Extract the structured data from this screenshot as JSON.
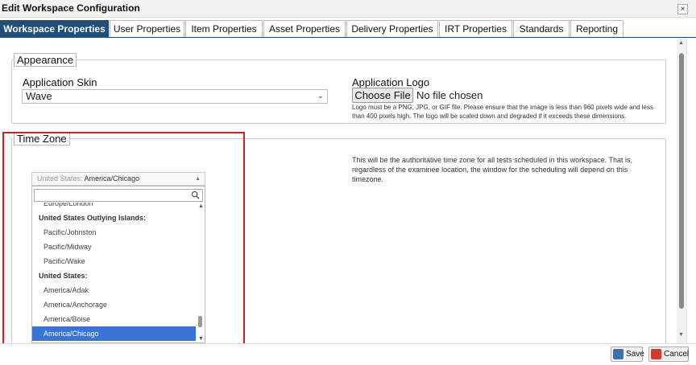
{
  "dialog": {
    "title": "Edit Workspace Configuration",
    "close_label": "×"
  },
  "tabs": [
    {
      "label": "Workspace Properties",
      "active": true
    },
    {
      "label": "User Properties"
    },
    {
      "label": "Item Properties"
    },
    {
      "label": "Asset Properties"
    },
    {
      "label": "Delivery Properties"
    },
    {
      "label": "IRT Properties"
    },
    {
      "label": "Standards"
    },
    {
      "label": "Reporting"
    }
  ],
  "appearance": {
    "legend": "Appearance",
    "skin_label": "Application Skin",
    "skin_value": "Wave",
    "logo_label": "Application Logo",
    "choose_file_label": "Choose File",
    "file_status": "No file chosen",
    "logo_hint": "Logo must be a PNG, JPG, or GIF file. Please ensure that the image is less than 960 pixels wide and less than 400 pixels high. The logo will be scaled down and degraded if it exceeds these dimensions."
  },
  "timezone": {
    "legend": "Time Zone",
    "selected_group": "United States: ",
    "selected_value": "America/Chicago",
    "search_placeholder": "",
    "description": "This will be the authoritative time zone for all tests scheduled in this workspace. That is, regardless of the examinee location, the window for the scheduling will depend on this timezone.",
    "options": [
      {
        "kind": "opt",
        "label": "Europe/London"
      },
      {
        "kind": "grp",
        "label": "United States Outlying Islands:"
      },
      {
        "kind": "opt",
        "label": "Pacific/Johnston"
      },
      {
        "kind": "opt",
        "label": "Pacific/Midway"
      },
      {
        "kind": "opt",
        "label": "Pacific/Wake"
      },
      {
        "kind": "grp",
        "label": "United States:"
      },
      {
        "kind": "opt",
        "label": "America/Adak"
      },
      {
        "kind": "opt",
        "label": "America/Anchorage"
      },
      {
        "kind": "opt",
        "label": "America/Boise"
      },
      {
        "kind": "opt",
        "label": "America/Chicago",
        "selected": true
      }
    ]
  },
  "footer": {
    "save_label": "Save",
    "cancel_label": "Cancel"
  },
  "colors": {
    "tab_active": "#1f4e79",
    "selected_option": "#3875d7",
    "highlight_box": "#d62020"
  }
}
